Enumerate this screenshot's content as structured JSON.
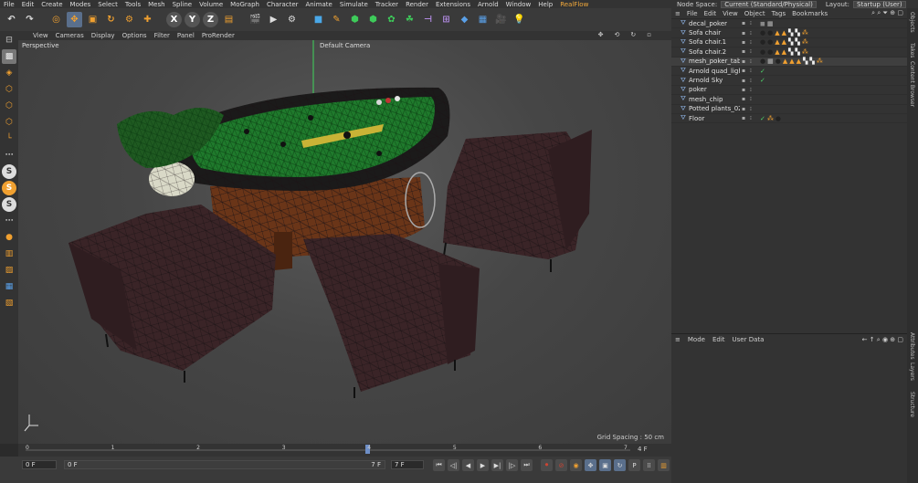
{
  "menubar": [
    "File",
    "Edit",
    "Create",
    "Modes",
    "Select",
    "Tools",
    "Mesh",
    "Spline",
    "Volume",
    "MoGraph",
    "Character",
    "Animate",
    "Simulate",
    "Tracker",
    "Render",
    "Extensions",
    "Arnold",
    "Window",
    "Help",
    "RealFlow"
  ],
  "top_right": {
    "node_space_label": "Node Space:",
    "node_space_value": "Current (Standard/Physical)",
    "layout_label": "Layout:",
    "layout_value": "Startup (User)"
  },
  "toolbar_icons": [
    "undo-icon",
    "redo-icon",
    "live-select-icon",
    "move-icon",
    "scale-icon",
    "rotate-icon",
    "render-settings-icon",
    "add-icon",
    "x-axis-icon",
    "y-axis-icon",
    "z-axis-icon",
    "world-coords-icon",
    "render-view-icon",
    "render-picture-queue-icon",
    "render-settings-icon",
    "cube-icon",
    "pen-icon",
    "subdivision-icon",
    "array-icon",
    "deformer-icon",
    "instance-icon",
    "bend-icon",
    "camera-icon",
    "floor-icon",
    "film-camera-icon",
    "light-icon"
  ],
  "viewport_menu": [
    "View",
    "Cameras",
    "Display",
    "Options",
    "Filter",
    "Panel",
    "ProRender"
  ],
  "viewport": {
    "view_name": "Perspective",
    "camera": "Default Camera",
    "grid_spacing": "Grid Spacing : 50 cm"
  },
  "timeline": {
    "ticks": [
      "0",
      "1",
      "2",
      "3",
      "4",
      "5",
      "6",
      "7"
    ],
    "end_frame": "4 F",
    "current_frame": "0 F",
    "range_start": "0 F",
    "range_end": "7 F",
    "max_frame": "7 F"
  },
  "objects_menu": [
    "File",
    "Edit",
    "View",
    "Object",
    "Tags",
    "Bookmarks"
  ],
  "objects": [
    {
      "name": "decal_poker",
      "tags": [
        "material-icon",
        "texture-icon"
      ]
    },
    {
      "name": "Sofa chair",
      "tags": [
        "sphere-material-icon",
        "sphere-material-icon",
        "triangle-tag-icon",
        "triangle-tag-icon",
        "checker-tag-icon",
        "checker-tag-icon",
        "dots-tag-icon"
      ]
    },
    {
      "name": "Sofa chair.1",
      "tags": [
        "sphere-material-icon",
        "sphere-material-icon",
        "triangle-tag-icon",
        "triangle-tag-icon",
        "checker-tag-icon",
        "checker-tag-icon",
        "dots-tag-icon"
      ]
    },
    {
      "name": "Sofa chair.2",
      "tags": [
        "sphere-material-icon",
        "sphere-material-icon",
        "triangle-tag-icon",
        "triangle-tag-icon",
        "checker-tag-icon",
        "checker-tag-icon",
        "dots-tag-icon"
      ]
    },
    {
      "name": "mesh_poker_table",
      "tags": [
        "sphere-material-icon",
        "texture-icon",
        "sphere-material-icon",
        "triangle-tag-icon",
        "triangle-tag-icon",
        "triangle-tag-icon",
        "checker-tag-icon",
        "checker-tag-icon",
        "dots-tag-icon"
      ]
    },
    {
      "name": "Arnold quad_light",
      "tags": [
        "check-icon"
      ]
    },
    {
      "name": "Arnold Sky",
      "tags": [
        "check-icon"
      ]
    },
    {
      "name": "poker",
      "tags": []
    },
    {
      "name": "mesh_chip",
      "tags": []
    },
    {
      "name": "Potted plants_02",
      "tags": []
    },
    {
      "name": "Floor",
      "tags": [
        "check-icon",
        "dots-tag-icon",
        "sphere-material-icon"
      ]
    }
  ],
  "attributes_menu": [
    "Mode",
    "Edit",
    "User Data"
  ],
  "side_tabs": [
    "Objects",
    "Takes",
    "Content Browser",
    "Attributes",
    "Layers",
    "Structure"
  ]
}
